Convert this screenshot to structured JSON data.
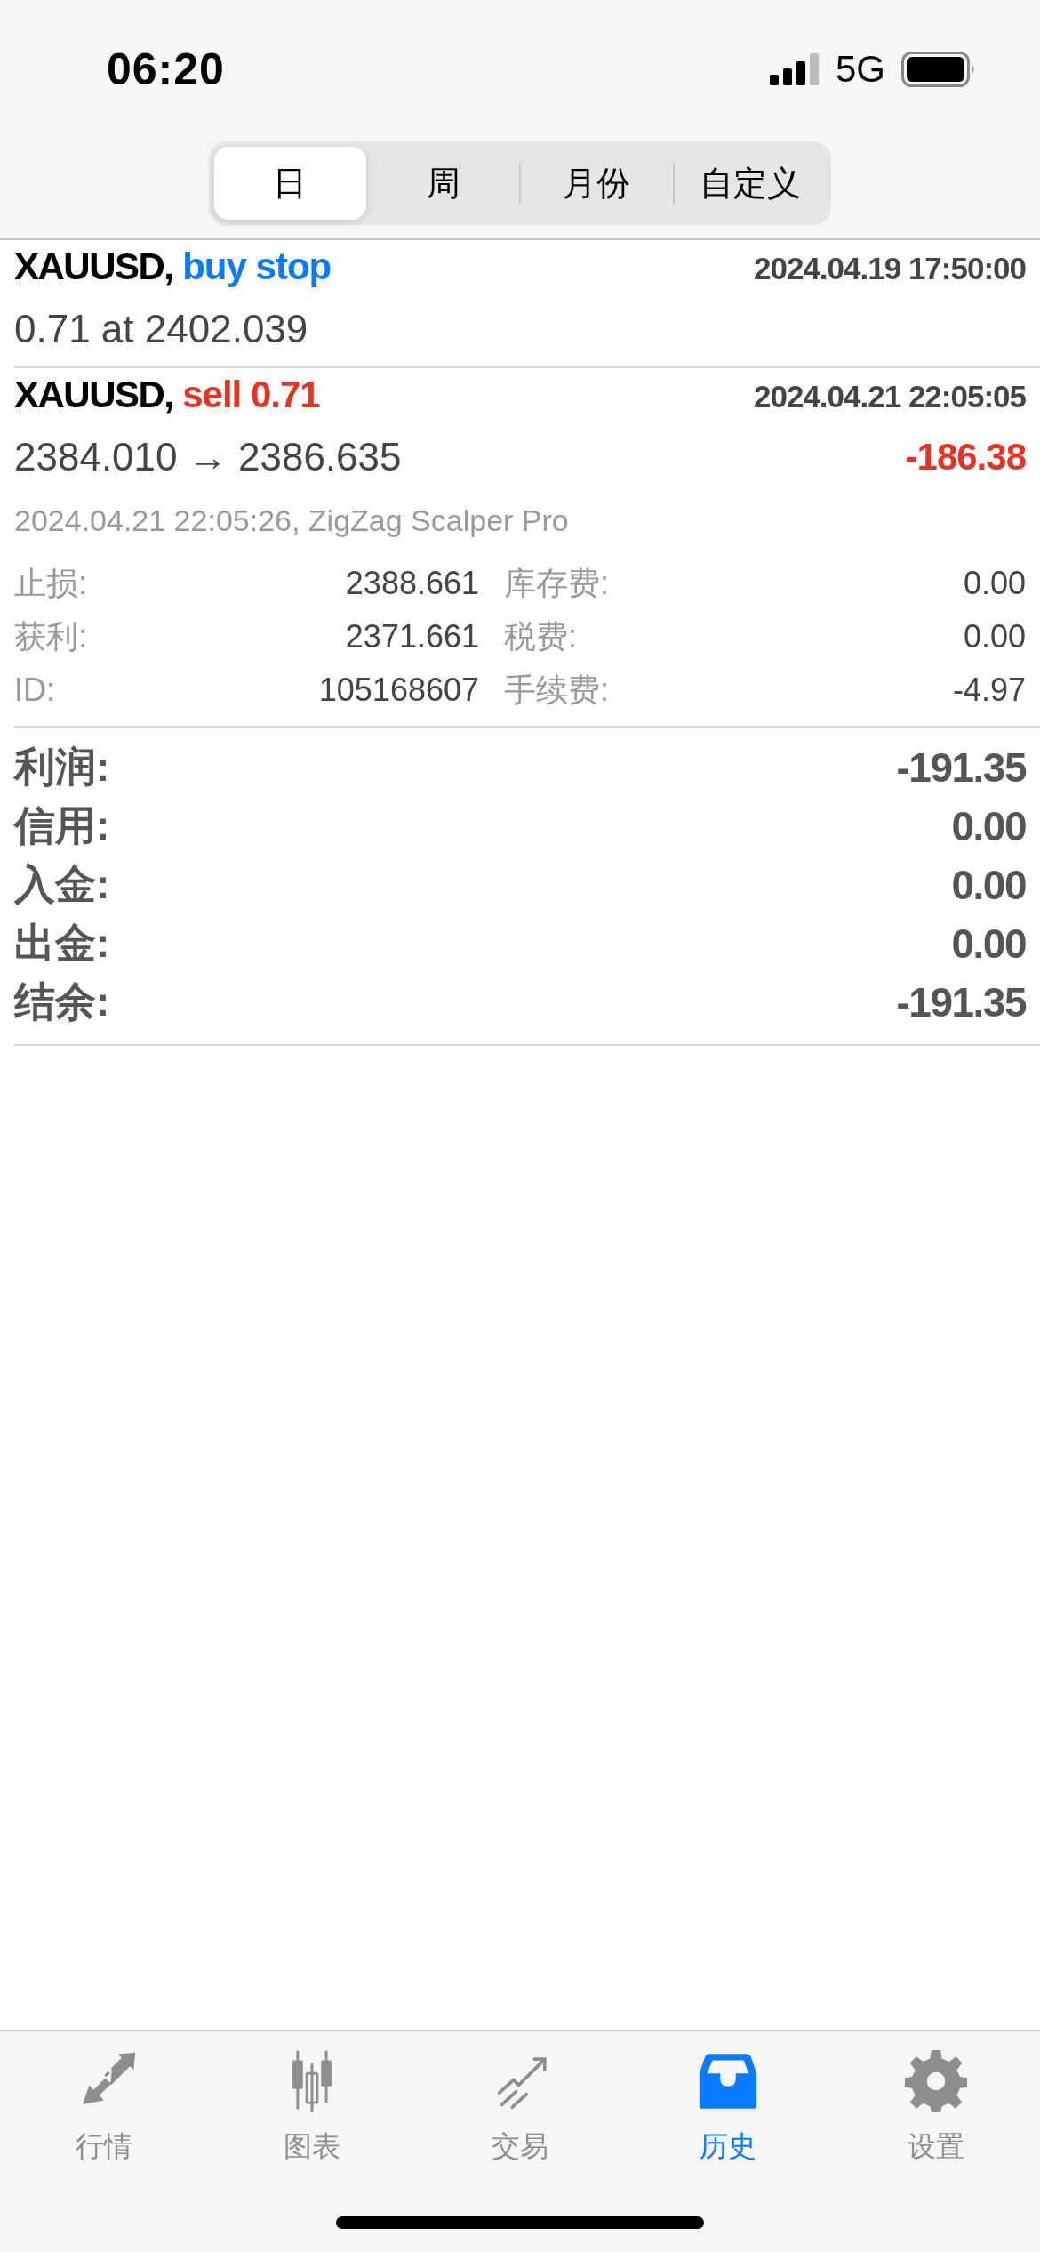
{
  "status_bar": {
    "time": "06:20",
    "network": "5G"
  },
  "segments": [
    {
      "label": "日",
      "selected": true
    },
    {
      "label": "周",
      "selected": false
    },
    {
      "label": "月份",
      "selected": false
    },
    {
      "label": "自定义",
      "selected": false
    }
  ],
  "orders": [
    {
      "symbol": "XAUUSD,",
      "action": "buy stop",
      "kind": "buy",
      "time": "2024.04.19 17:50:00",
      "price": "0.71 at 2402.039"
    },
    {
      "symbol": "XAUUSD,",
      "action": "sell 0.71",
      "kind": "sell",
      "time": "2024.04.21 22:05:05",
      "price": "2384.010 → 2386.635",
      "profit": {
        "value": "-186.38",
        "kind": "loss"
      },
      "details": {
        "comment": "2024.04.21 22:05:26, ZigZag Scalper Pro",
        "fields": [
          {
            "label": "止损:",
            "value": "2388.661"
          },
          {
            "label": "库存费:",
            "value": "0.00"
          },
          {
            "label": "获利:",
            "value": "2371.661"
          },
          {
            "label": "税费:",
            "value": "0.00"
          },
          {
            "label": "ID:",
            "value": "105168607"
          },
          {
            "label": "手续费:",
            "value": "-4.97"
          }
        ]
      }
    }
  ],
  "summary": [
    {
      "label": "利润:",
      "value": "-191.35"
    },
    {
      "label": "信用:",
      "value": "0.00"
    },
    {
      "label": "入金:",
      "value": "0.00"
    },
    {
      "label": "出金:",
      "value": "0.00"
    },
    {
      "label": "结余:",
      "value": "-191.35"
    }
  ],
  "tab_bar": [
    {
      "label": "行情",
      "selected": false
    },
    {
      "label": "图表",
      "selected": false
    },
    {
      "label": "交易",
      "selected": false
    },
    {
      "label": "历史",
      "selected": true
    },
    {
      "label": "设置",
      "selected": false
    }
  ]
}
